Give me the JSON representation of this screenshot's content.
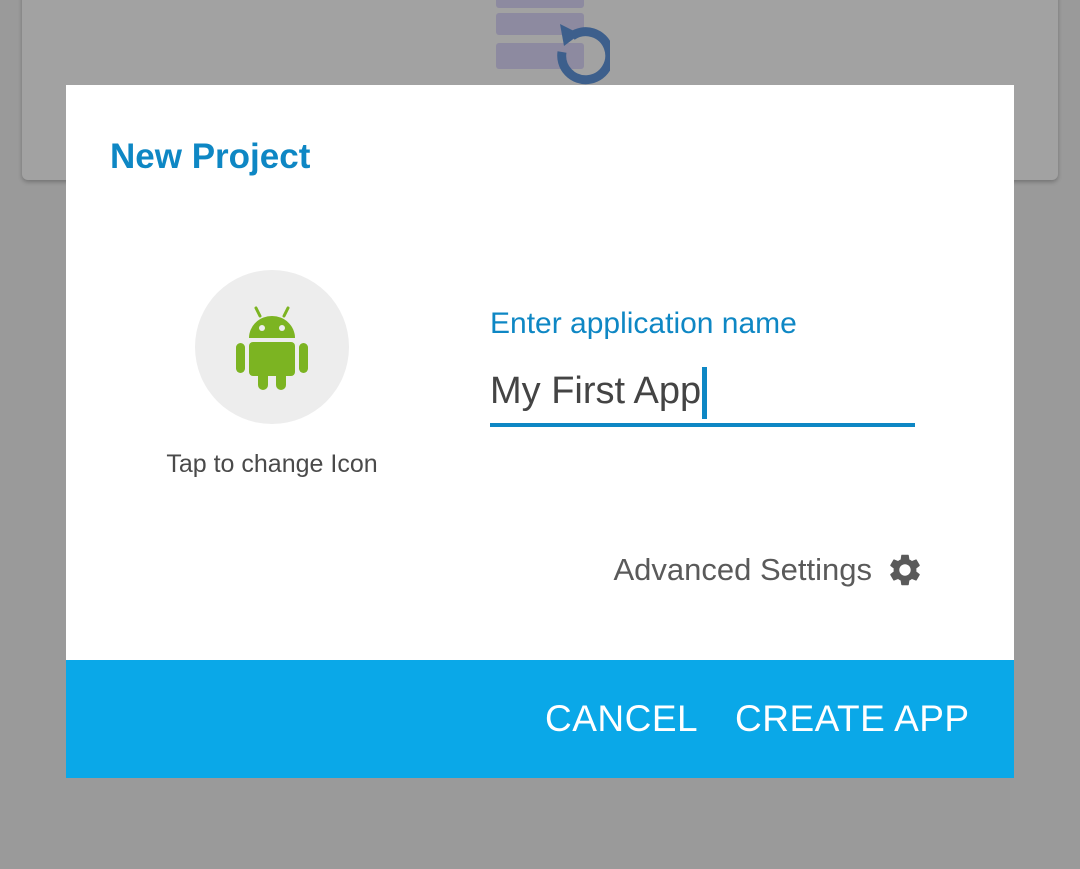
{
  "dialog": {
    "title": "New Project",
    "icon_caption": "Tap to change Icon",
    "name_label": "Enter application name",
    "name_value": "My First App",
    "advanced_label": "Advanced Settings",
    "cancel_label": "CANCEL",
    "create_label": "CREATE APP"
  },
  "icons": {
    "app_icon": "android-icon",
    "advanced_icon": "gear-icon",
    "background_icon": "database-restore-icon"
  },
  "colors": {
    "accent": "#0e87c4",
    "action_bar": "#0aa8e8",
    "android_green": "#7cb422",
    "overlay": "#9a9a9a"
  }
}
